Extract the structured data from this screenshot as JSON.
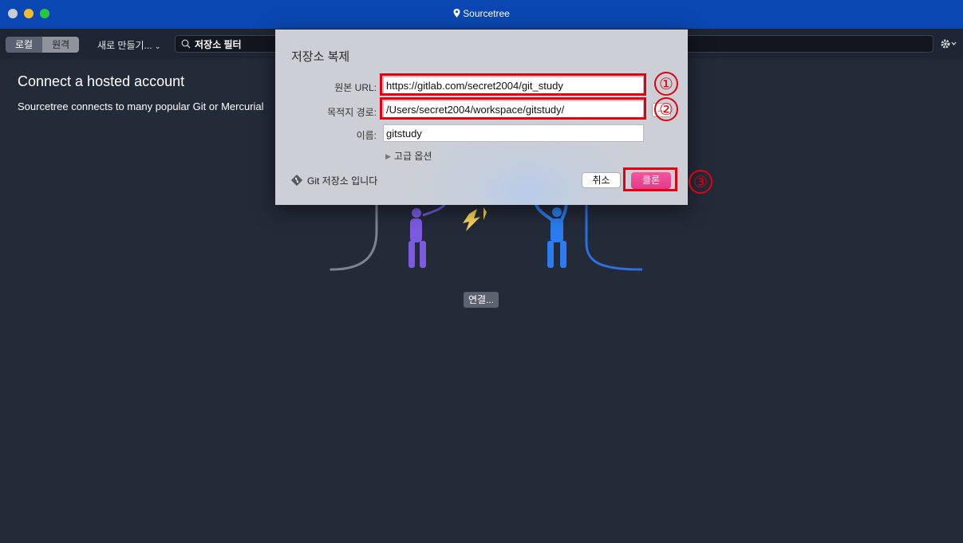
{
  "window": {
    "title": "Sourcetree"
  },
  "toolbar": {
    "local_tab": "로컬",
    "remote_tab": "원격",
    "new_menu": "새로 만들기...",
    "search_value": "저장소 필터"
  },
  "content": {
    "heading": "Connect a hosted account",
    "subtext": "Sourcetree connects to many popular Git or Mercurial",
    "connect_button": "연결..."
  },
  "dialog": {
    "title": "저장소 복제",
    "source_label": "원본 URL:",
    "source_value": "https://gitlab.com/secret2004/git_study",
    "dest_label": "목적지 경로:",
    "dest_value": "/Users/secret2004/workspace/gitstudy/",
    "browse_label": "...",
    "name_label": "이름:",
    "name_value": "gitstudy",
    "advanced_label": "고급 옵션",
    "repo_status": "Git 저장소 입니다",
    "cancel_label": "취소",
    "clone_label": "클론"
  },
  "annotations": {
    "step1": "①",
    "step2": "②",
    "step3": "③",
    "color": "#e00012"
  },
  "colors": {
    "accent": "#0b47b3",
    "clone_button": "#ec4592",
    "background": "#232a38"
  }
}
